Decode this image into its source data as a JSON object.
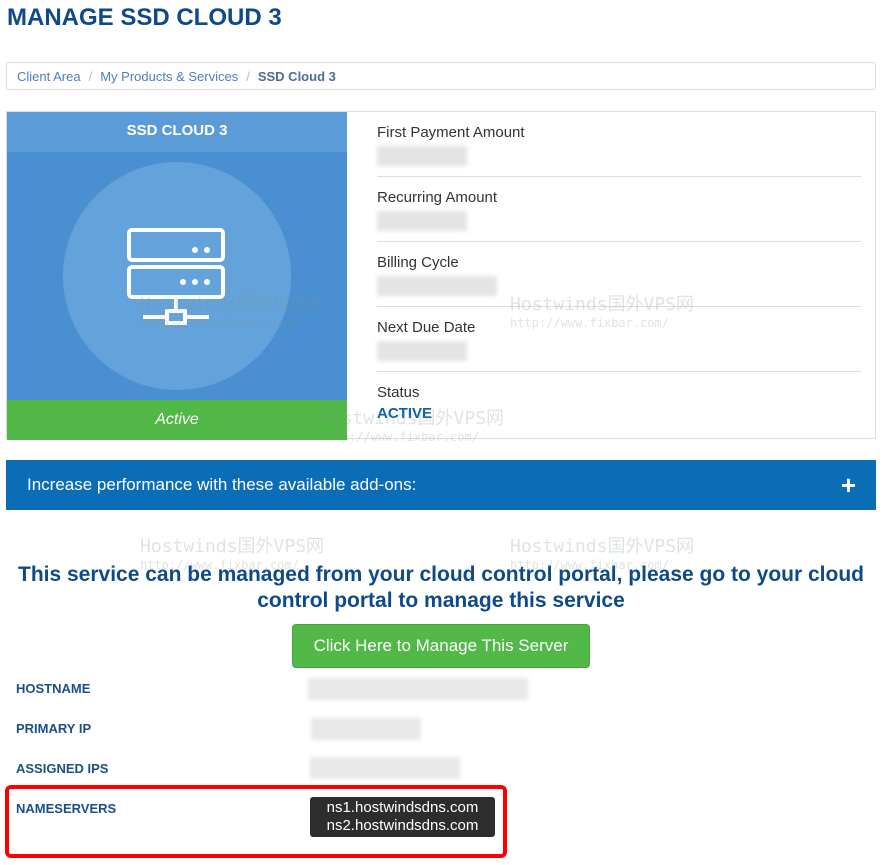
{
  "page_title": "MANAGE SSD CLOUD 3",
  "breadcrumb": [
    "Client Area",
    "My Products & Services",
    "SSD Cloud 3"
  ],
  "product": {
    "name": "SSD CLOUD 3",
    "status": "Active",
    "icon": "server-icon"
  },
  "billing": {
    "first_payment_label": "First Payment Amount",
    "recurring_label": "Recurring Amount",
    "cycle_label": "Billing Cycle",
    "next_due_label": "Next Due Date",
    "status_label": "Status",
    "status_value": "ACTIVE"
  },
  "addons": {
    "label": "Increase performance with these available add-ons:",
    "expand": "+"
  },
  "message": "This service can be managed from your cloud control portal, please go to your cloud control portal to manage this service",
  "manage_button": "Click Here to Manage This Server",
  "details": {
    "hostname_label": "HOSTNAME",
    "primary_ip_label": "PRIMARY IP",
    "assigned_ips_label": "ASSIGNED IPS",
    "nameservers_label": "NAMESERVERS",
    "nameservers": [
      "ns1.hostwindsdns.com",
      "ns2.hostwindsdns.com"
    ]
  },
  "watermark": {
    "title": "Hostwinds国外VPS网",
    "url": "http://www.fixbar.com/"
  }
}
